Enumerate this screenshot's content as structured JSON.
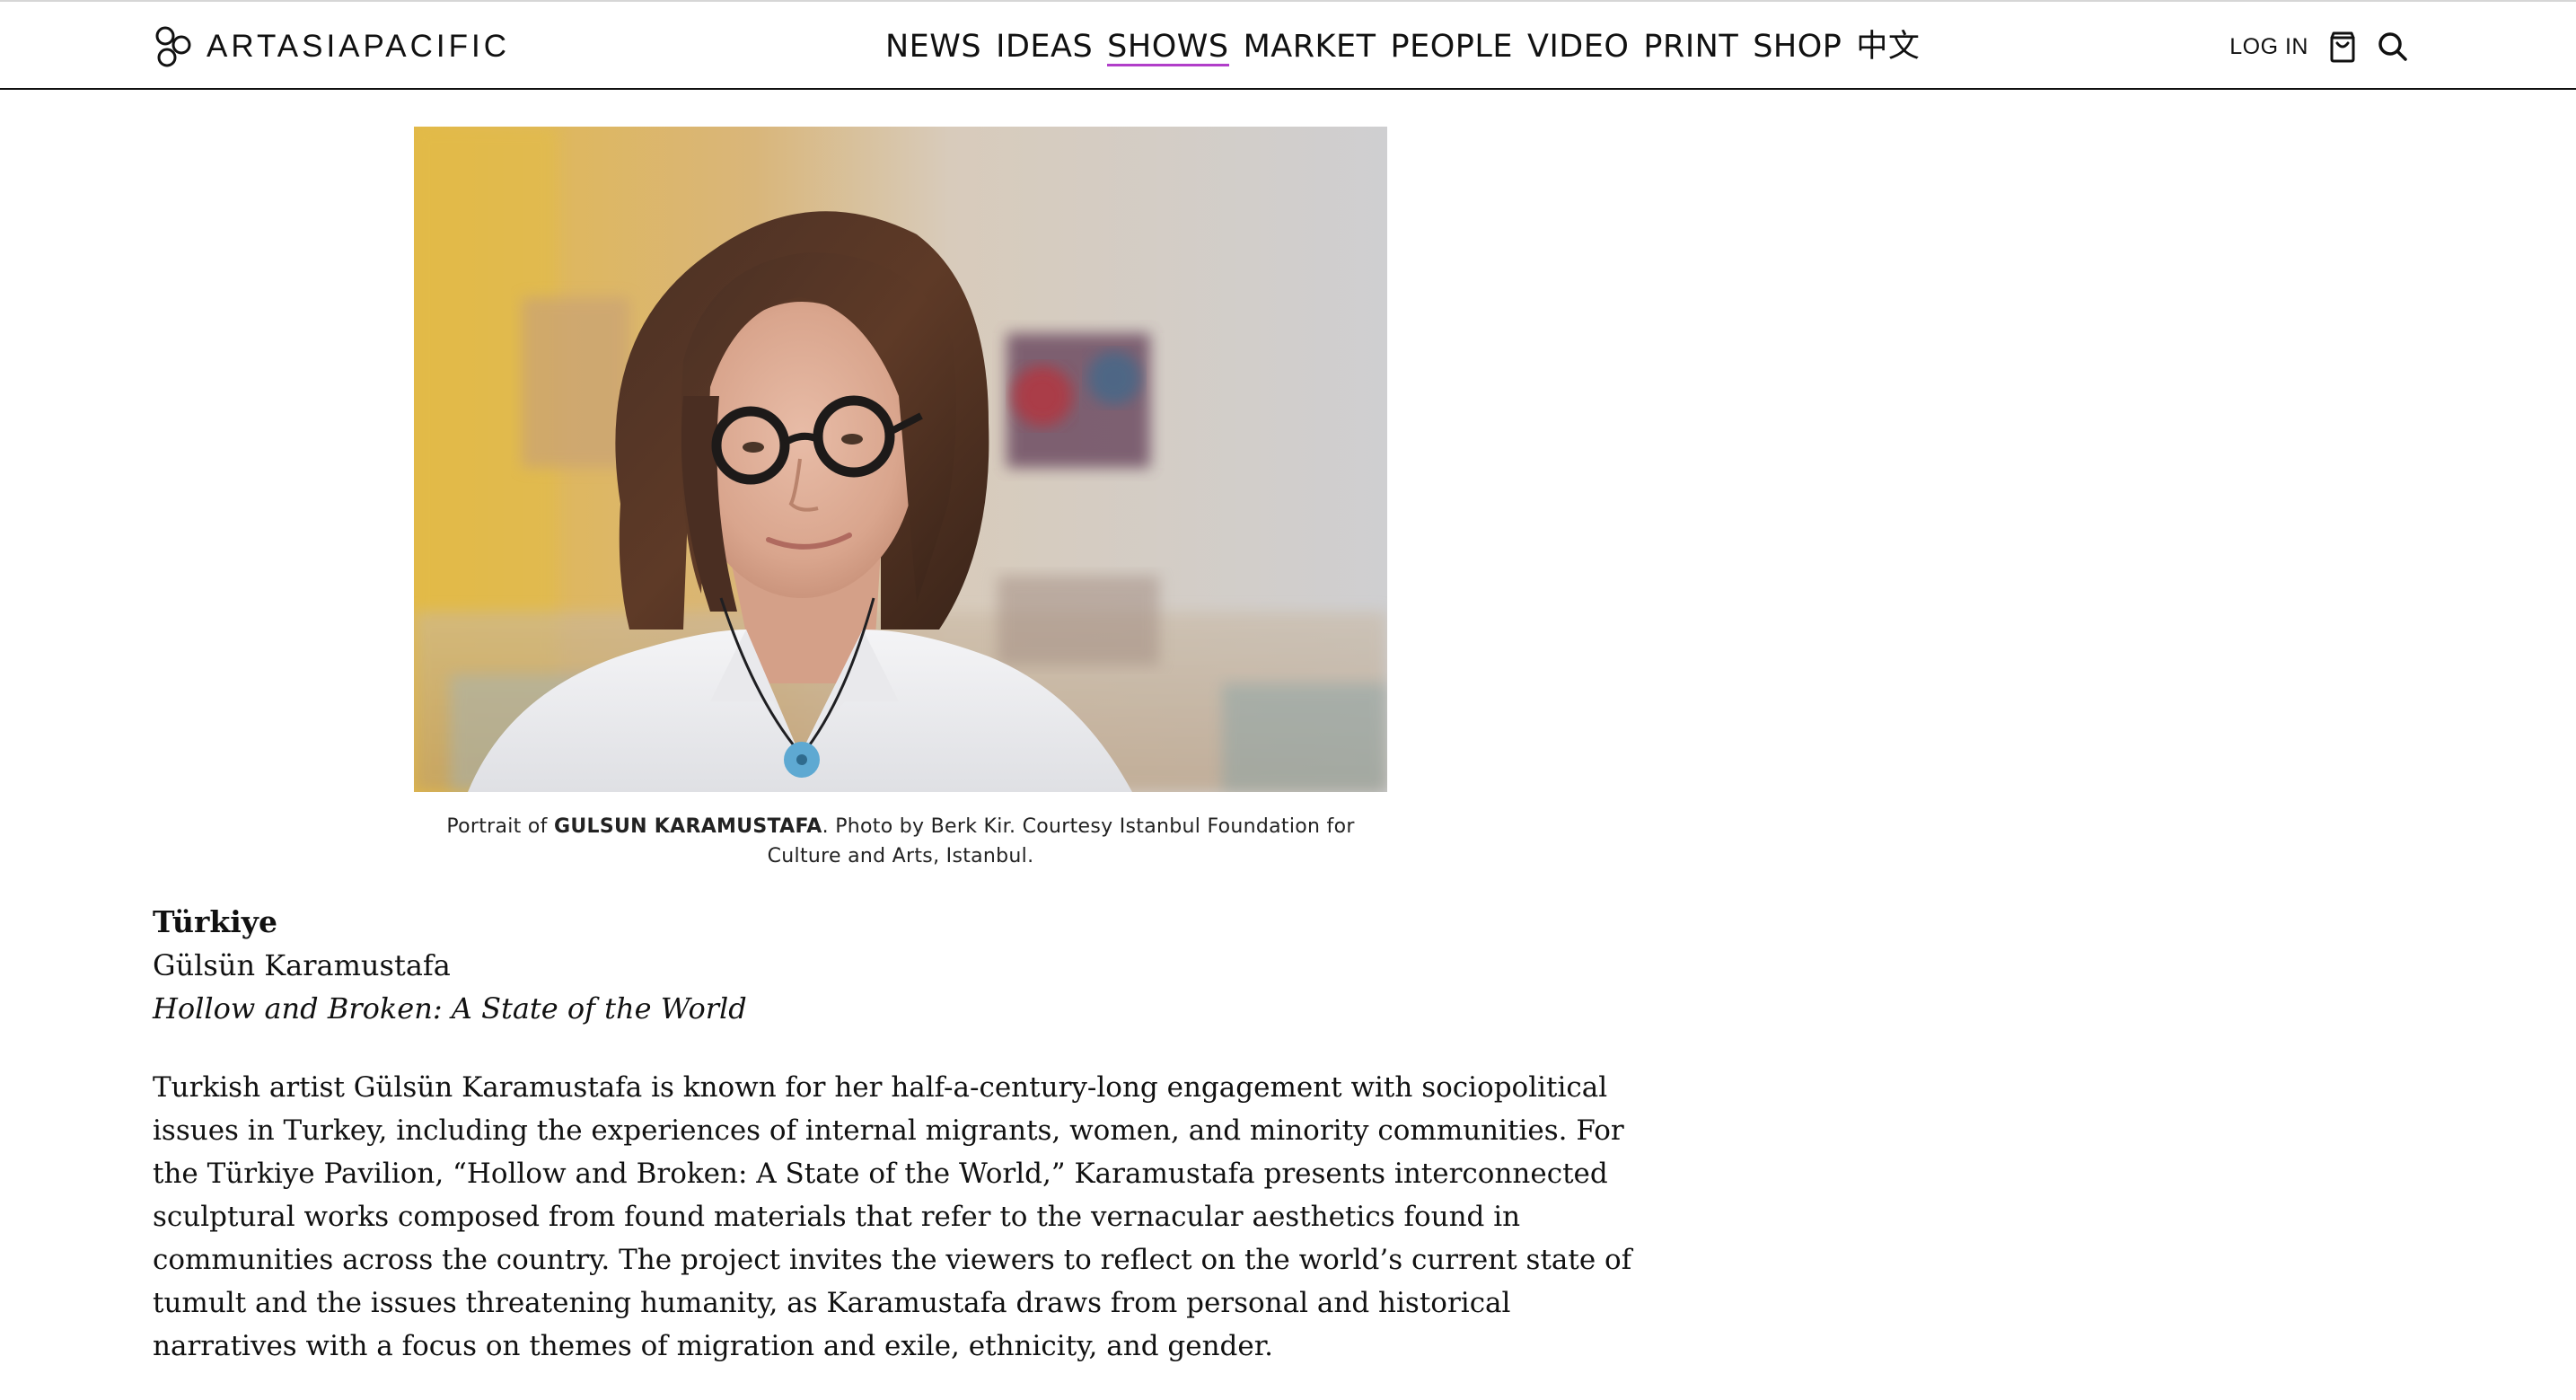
{
  "header": {
    "logo_text": "ARTASIAPACIFIC",
    "nav": [
      {
        "label": "NEWS"
      },
      {
        "label": "IDEAS"
      },
      {
        "label": "SHOWS",
        "active": true
      },
      {
        "label": "MARKET"
      },
      {
        "label": "PEOPLE"
      },
      {
        "label": "VIDEO"
      },
      {
        "label": "PRINT"
      },
      {
        "label": "SHOP"
      },
      {
        "label": "中文"
      }
    ],
    "login_label": "LOG IN",
    "icons": [
      "cart-icon",
      "search-icon"
    ],
    "accent_color": "#b13ec9"
  },
  "figure": {
    "caption_prefix": "Portrait of ",
    "caption_name": "GULSUN KARAMUSTAFA",
    "caption_suffix": ". Photo by Berk Kir. Courtesy Istanbul Foundation for Culture and Arts, Istanbul."
  },
  "article": {
    "country": "Türkiye",
    "artist": "Gülsün Karamustafa",
    "show_title": "Hollow and Broken: A State of the World",
    "body": "Turkish artist Gülsün Karamustafa is known for her half-a-century-long engagement with sociopolitical issues in Turkey, including the experiences of internal migrants, women, and minority communities. For the Türkiye Pavilion, “Hollow and Broken: A State of the World,” Karamustafa presents interconnected sculptural works composed from found materials that refer to the vernacular aesthetics found in communities across the country. The project invites the viewers to reflect on the world’s current state of tumult and the issues threatening humanity, as Karamustafa draws from personal and historical narratives with a focus on themes of migration and exile, ethnicity, and gender."
  }
}
